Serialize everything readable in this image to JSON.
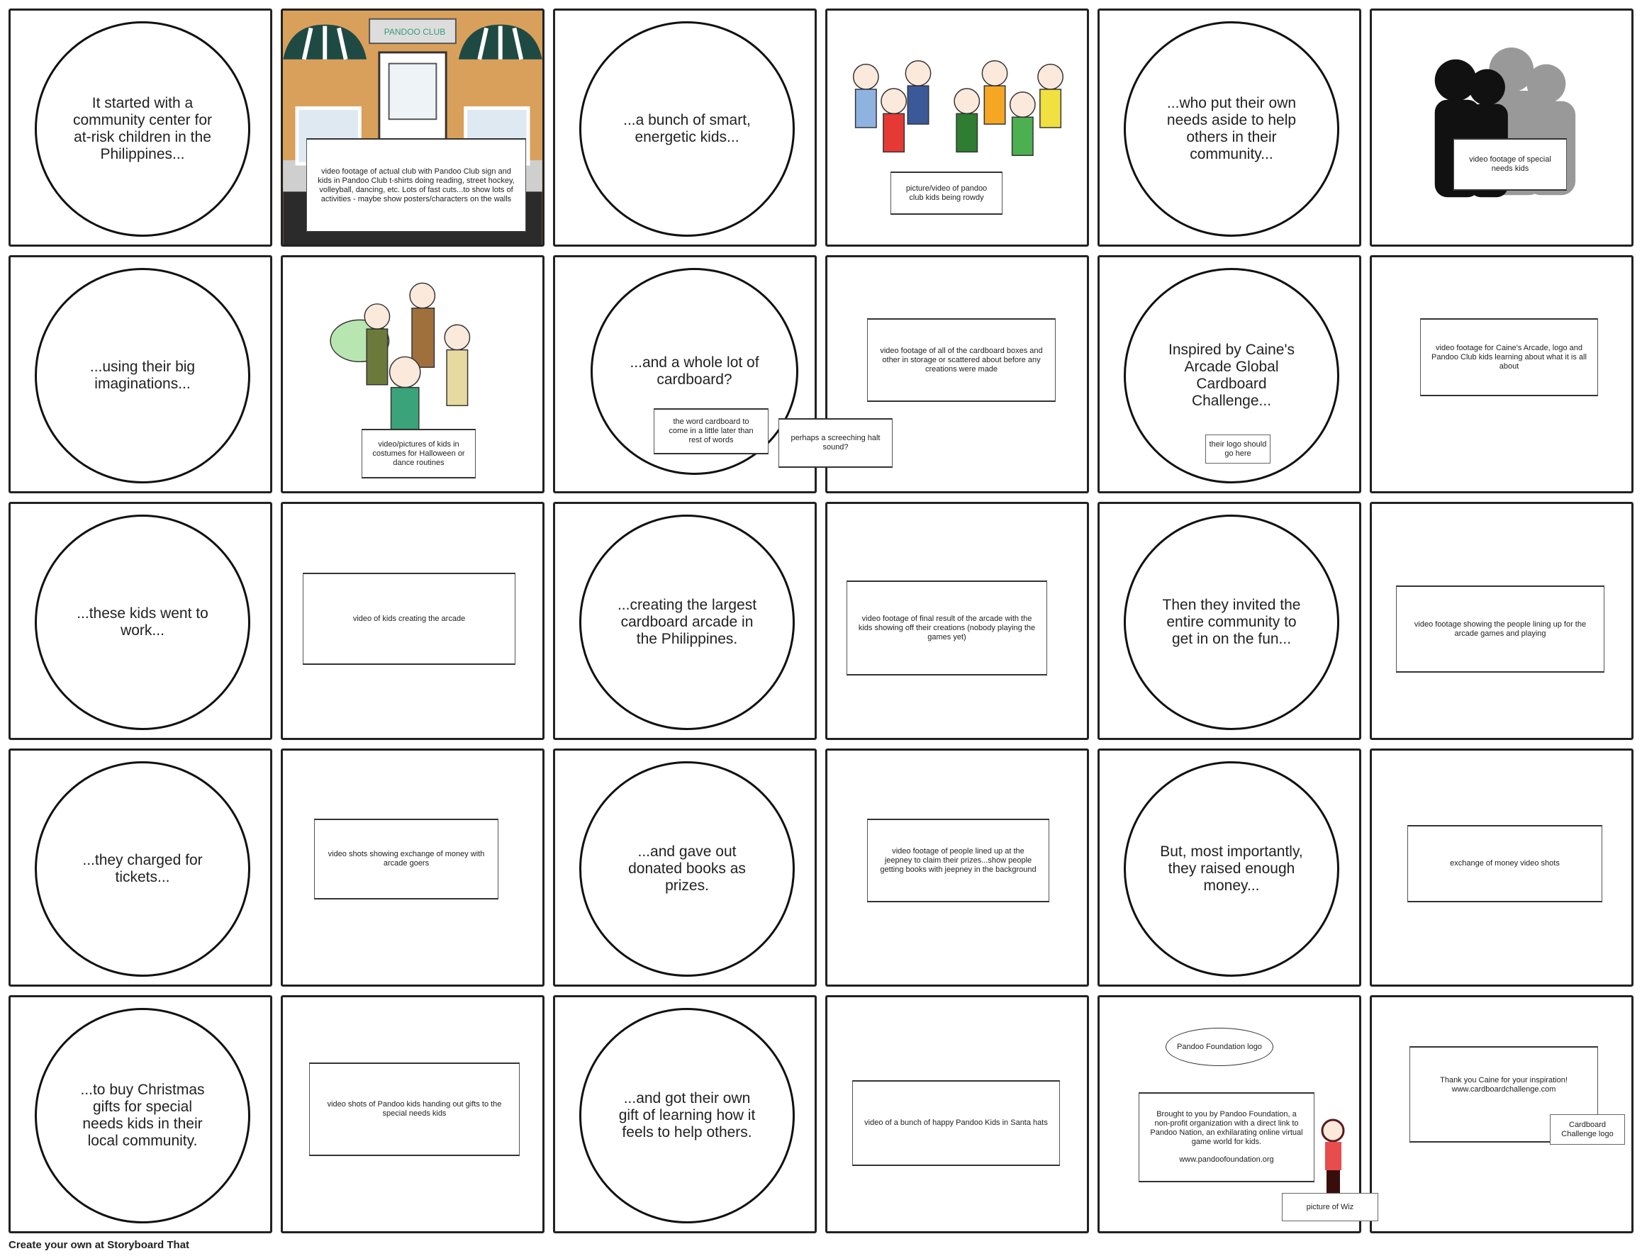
{
  "panels": [
    {
      "circle": "It started with a community center for at-risk children in the Philippines..."
    },
    {
      "sign": "PANDOO CLUB",
      "caption": "video footage of actual club with Pandoo Club sign and kids in Pandoo Club t-shirts doing reading, street hockey, volleyball, dancing, etc. Lots of fast cuts...to show lots of activities - maybe show posters/characters on the walls"
    },
    {
      "circle": "...a bunch of smart, energetic kids..."
    },
    {
      "caption": "picture/video of pandoo club kids being rowdy"
    },
    {
      "circle": "...who put their own needs aside to help others in their community..."
    },
    {
      "caption": "video footage of special needs kids"
    },
    {
      "circle": "...using their big imaginations..."
    },
    {
      "caption": "video/pictures of kids in costumes for Halloween or dance routines"
    },
    {
      "circle": "...and a whole lot of cardboard?",
      "note1": "the word cardboard to come in a little later than rest of words",
      "note2": "perhaps a screeching halt sound?"
    },
    {
      "caption": "video footage of all of the cardboard boxes and other in storage or scattered about before any creations were made"
    },
    {
      "circle": "Inspired by Caine's Arcade Global Cardboard Challenge...",
      "note1": "their logo should go here"
    },
    {
      "caption": "video footage for Caine's Arcade, logo and Pandoo Club kids learning about what it is all about"
    },
    {
      "circle": "...these kids went to work..."
    },
    {
      "caption": "video of kids creating the arcade"
    },
    {
      "circle": "...creating the largest cardboard arcade in the Philippines."
    },
    {
      "caption": "video footage of final result of the arcade with the kids showing off their creations (nobody playing the games yet)"
    },
    {
      "circle": "Then they invited the entire community to get in on the fun..."
    },
    {
      "caption": "video footage showing the people lining up for the arcade games and playing"
    },
    {
      "circle": "...they charged for tickets..."
    },
    {
      "caption": "video shots showing exchange of money with arcade goers"
    },
    {
      "circle": "...and gave out donated books as prizes."
    },
    {
      "caption": "video footage of people lined up at the jeepney to claim their prizes...show people getting books with jeepney in the background"
    },
    {
      "circle": "But, most importantly, they raised enough money..."
    },
    {
      "caption": "exchange of money video shots"
    },
    {
      "circle": "...to buy Christmas gifts for special needs kids in their local community."
    },
    {
      "caption": "video shots of Pandoo kids handing out gifts to the special needs kids"
    },
    {
      "circle": "...and got their own gift of learning how it feels to help others."
    },
    {
      "caption": "video of a bunch of happy Pandoo Kids in Santa hats"
    },
    {
      "ellipse": "Pandoo Foundation logo",
      "caption": "Brought to you by Pandoo Foundation, a non-profit organization with a direct link to Pandoo Nation, an exhilarating online virtual game world for kids.",
      "url": "www.pandoofoundation.org",
      "note1": "picture of Wiz"
    },
    {
      "caption": "Thank you Caine for your inspiration!",
      "url": "www.cardboardchallenge.com",
      "note1": "Cardboard Challenge logo"
    }
  ],
  "footer": "Create your own at Storyboard That",
  "colors": {
    "wall": "#d9a05b",
    "awning": "#1f4a44",
    "sign_text": "#3a9a7a"
  }
}
